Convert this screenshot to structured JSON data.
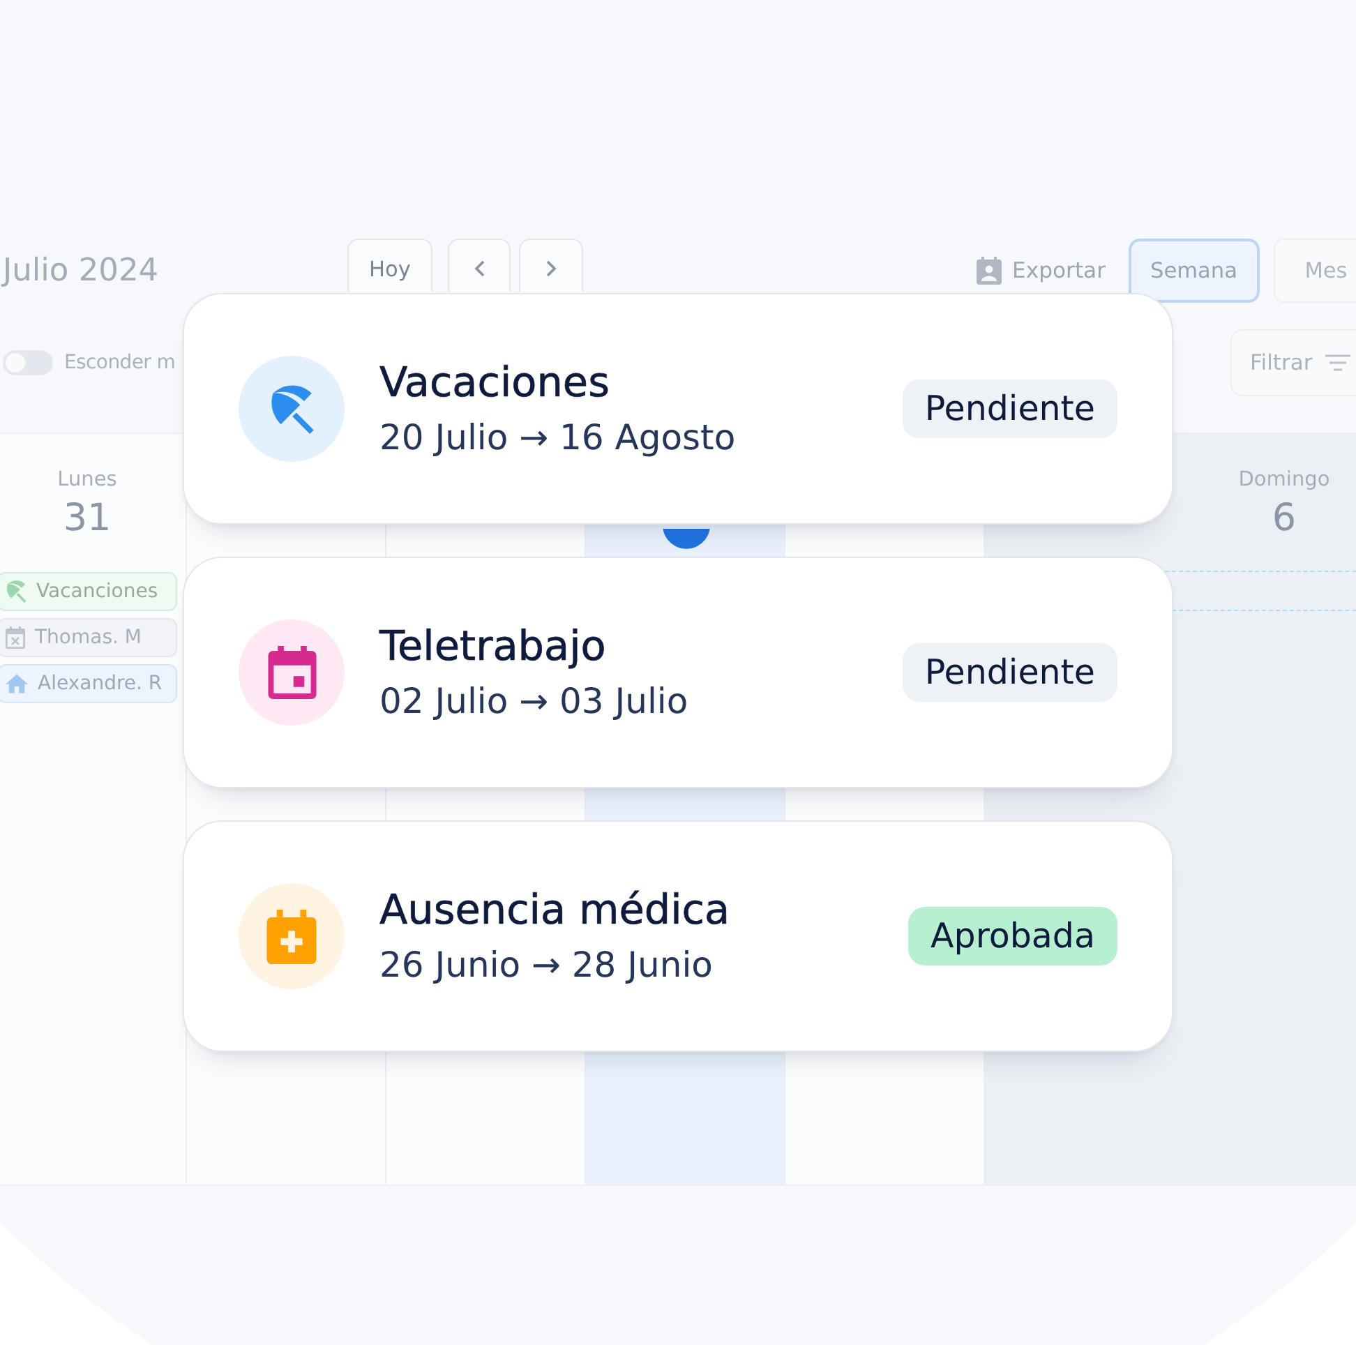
{
  "calendar": {
    "title": "Julio 2024",
    "today_button": "Hoy",
    "export_button": "Exportar",
    "views": [
      {
        "label": "Semana",
        "selected": true
      },
      {
        "label": "Mes",
        "selected": false
      }
    ],
    "hide_toggle": {
      "label": "Esconder m",
      "on": false
    },
    "filter_button": "Filtrar",
    "days": [
      {
        "name": "Lunes",
        "number": "31",
        "today": false,
        "weekend": false,
        "events": [
          {
            "kind": "vacation",
            "label": "Vacanciones"
          },
          {
            "kind": "absence",
            "label": "Thomas. M"
          },
          {
            "kind": "remote",
            "label": "Alexandre. R"
          }
        ]
      },
      {
        "today": false,
        "weekend": false
      },
      {
        "today": false,
        "weekend": false
      },
      {
        "today": true,
        "weekend": false
      },
      {
        "today": false,
        "weekend": false
      },
      {
        "today": false,
        "weekend": true
      },
      {
        "name": "Domingo",
        "number": "6",
        "today": false,
        "weekend": true
      }
    ]
  },
  "requests": [
    {
      "kind": "vacation",
      "title": "Vacaciones",
      "dates": "20 Julio → 16 Agosto",
      "status": {
        "kind": "pending",
        "label": "Pendiente"
      }
    },
    {
      "kind": "remote",
      "title": "Teletrabajo",
      "dates": "02 Julio → 03 Julio",
      "status": {
        "kind": "pending",
        "label": "Pendiente"
      }
    },
    {
      "kind": "medical",
      "title": "Ausencia médica",
      "dates": "26 Junio → 28 Junio",
      "status": {
        "kind": "approved",
        "label": "Aprobada"
      }
    }
  ]
}
